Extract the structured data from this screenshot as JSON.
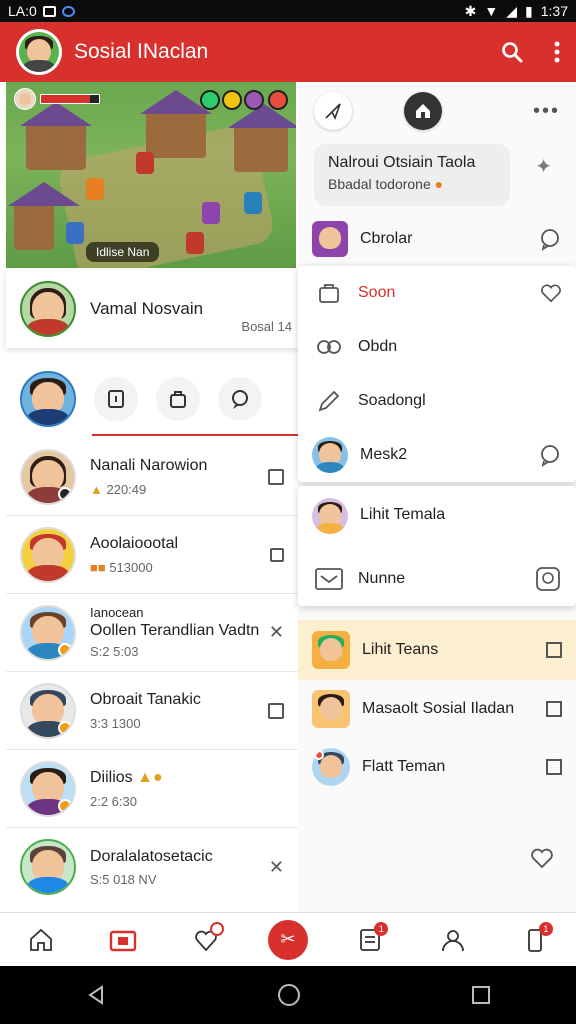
{
  "status_bar": {
    "time": "1:37",
    "left_text": "LA:0"
  },
  "app_bar": {
    "title": "Sosial INaclan",
    "search_icon": "search-icon",
    "menu_icon": "more-vert-icon"
  },
  "game_banner": {
    "label": "Idlise Nan"
  },
  "featured": {
    "name": "Vamal Nosvain",
    "sub": "Bosal 14"
  },
  "contacts": [
    {
      "name": "Nanali Narowion",
      "sub": "220:49"
    },
    {
      "name": "Aoolaioootal",
      "sub": "513000"
    },
    {
      "name": "Ianocean",
      "name2": "Oollen Terandlian Vadtn",
      "sub": "S:2 5:03"
    },
    {
      "name": "Obroait Tanakic",
      "sub": "3:3 1300"
    },
    {
      "name": "Diilios",
      "sub": "2:2 6:30"
    },
    {
      "name": "Doralalatosetacic",
      "sub": "S:5 018 NV"
    }
  ],
  "panel": {
    "bubble_title": "Nalroui Otsiain Taola",
    "bubble_sub": "Bbadal todorone",
    "first_item": "Cbrolar",
    "menu": [
      "Soon",
      "Obdn",
      "Soadongl",
      "Mesk2"
    ],
    "menu2": [
      "Lihit Temala",
      "Nunne"
    ],
    "list": [
      "Lihit Teans",
      "Masaolt Sosial Iladan",
      "Flatt Teman"
    ]
  },
  "nav_badges": {
    "notes": "1",
    "profile": "1"
  },
  "colors": {
    "accent": "#d8302d",
    "highlight": "#fcefd0"
  }
}
